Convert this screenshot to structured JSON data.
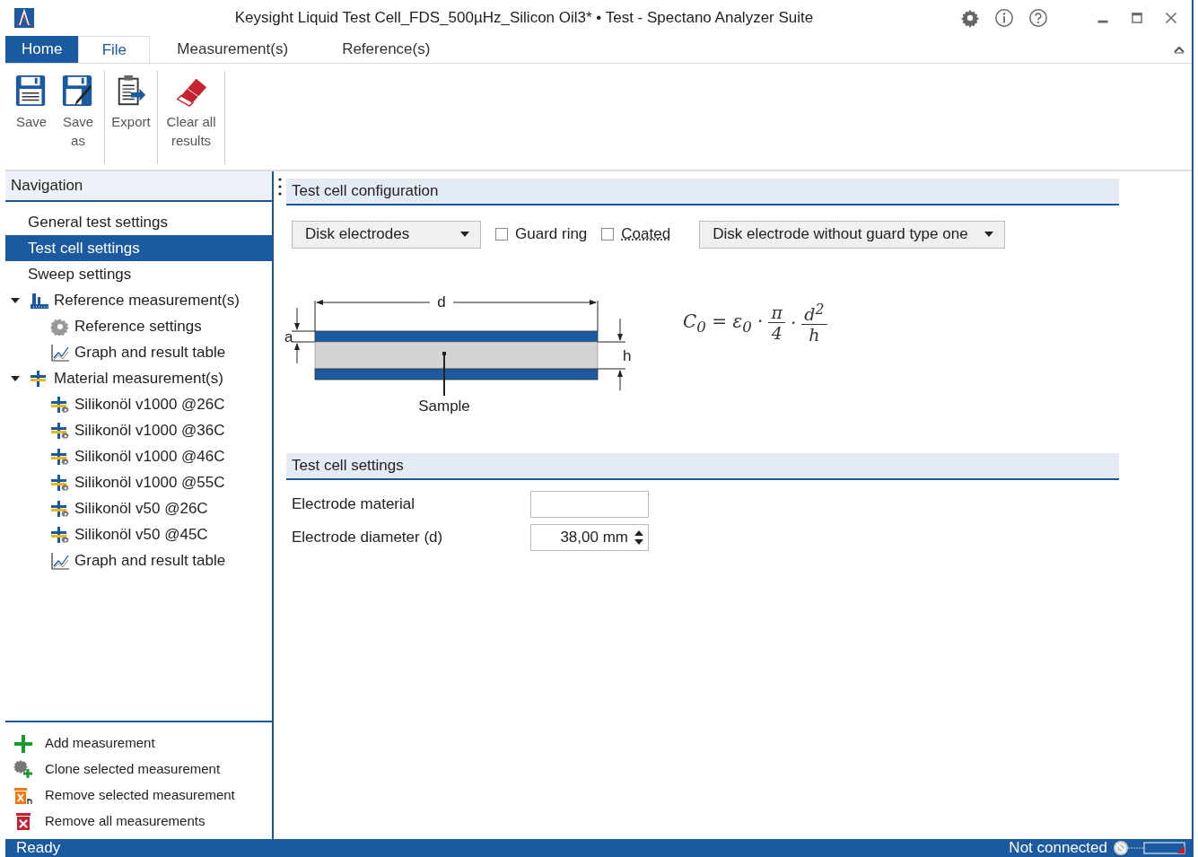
{
  "window": {
    "title": "Keysight Liquid Test Cell_FDS_500µHz_Silicon Oil3* • Test - Spectano Analyzer Suite"
  },
  "tabs": [
    {
      "label": "Home",
      "selected": true
    },
    {
      "label": "File",
      "selected": false
    },
    {
      "label": "Measurement(s)",
      "selected": false
    },
    {
      "label": "Reference(s)",
      "selected": false
    }
  ],
  "ribbon": {
    "groups": [
      [
        {
          "kind": "save",
          "label": "Save"
        },
        {
          "kind": "save-as",
          "label": "Save as"
        }
      ],
      [
        {
          "kind": "export",
          "label": "Export"
        }
      ],
      [
        {
          "kind": "clear",
          "label": "Clear all results"
        }
      ]
    ]
  },
  "navigation": {
    "title": "Navigation",
    "items": [
      {
        "label": "General test settings",
        "kind": "plain",
        "selected": false
      },
      {
        "label": "Test cell settings",
        "kind": "plain",
        "selected": true
      },
      {
        "label": "Sweep settings",
        "kind": "plain",
        "selected": false
      },
      {
        "label": "Reference measurement(s)",
        "kind": "reference-group",
        "selected": false,
        "expanded": true,
        "children": [
          {
            "label": "Reference settings",
            "kind": "settings",
            "selected": false
          },
          {
            "label": "Graph and result table",
            "kind": "graph",
            "selected": false
          }
        ]
      },
      {
        "label": "Material measurement(s)",
        "kind": "material-group",
        "selected": false,
        "expanded": true,
        "children": [
          {
            "label": "Silikonöl v1000 @26C",
            "kind": "measurement",
            "selected": false
          },
          {
            "label": "Silikonöl v1000 @36C",
            "kind": "measurement",
            "selected": false
          },
          {
            "label": "Silikonöl v1000 @46C",
            "kind": "measurement",
            "selected": false
          },
          {
            "label": "Silikonöl v1000 @55C",
            "kind": "measurement",
            "selected": false
          },
          {
            "label": "Silikonöl v50 @26C",
            "kind": "measurement",
            "selected": false
          },
          {
            "label": "Silikonöl v50 @45C",
            "kind": "measurement",
            "selected": false
          },
          {
            "label": "Graph and result table",
            "kind": "graph",
            "selected": false
          }
        ]
      }
    ],
    "actions": [
      {
        "kind": "add",
        "label": "Add measurement"
      },
      {
        "kind": "clone",
        "label": "Clone selected measurement"
      },
      {
        "kind": "remove",
        "label": "Remove selected measurement"
      },
      {
        "kind": "remove-all",
        "label": "Remove all measurements"
      }
    ]
  },
  "configuration": {
    "title": "Test cell configuration",
    "electrode_type": "Disk electrodes",
    "guard_ring": {
      "label": "Guard ring",
      "checked": false
    },
    "coated": {
      "label": "Coated",
      "checked": false
    },
    "variant": "Disk electrode without guard type one",
    "diagram": {
      "d": "d",
      "a": "a",
      "h": "h",
      "sample": "Sample"
    },
    "formula": [
      {
        "kind": "text",
        "text": "C$_{0}$ = ε$_{0}$ ·"
      },
      {
        "kind": "fraction",
        "num": "π",
        "den": "4"
      },
      {
        "kind": "text",
        "text": "·"
      },
      {
        "kind": "fraction",
        "num": "d$^{2}$",
        "den": "h"
      }
    ]
  },
  "settings": {
    "title": "Test cell settings",
    "fields": [
      {
        "label": "Electrode material",
        "kind": "text"
      },
      {
        "label": "Electrode diameter (d)",
        "kind": "spin",
        "value": "38,00 mm"
      }
    ]
  },
  "status_bar": {
    "left": "Ready",
    "right": "Not connected"
  }
}
